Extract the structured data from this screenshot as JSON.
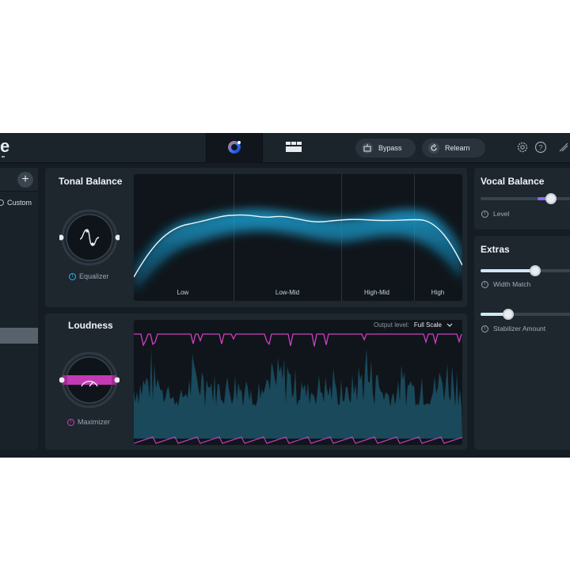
{
  "app": {
    "logo_letter": "e"
  },
  "toolbar": {
    "bypass_label": "Bypass",
    "relearn_label": "Relearn"
  },
  "left_panel": {
    "item_label": "Custom"
  },
  "tonal_balance": {
    "title": "Tonal Balance",
    "module_label": "Equalizer",
    "bands": [
      "Low",
      "Low-Mid",
      "High-Mid",
      "High"
    ]
  },
  "loudness": {
    "title": "Loudness",
    "module_label": "Maximizer",
    "output_level_label": "Output level:",
    "output_level_value": "Full Scale"
  },
  "vocal_balance": {
    "title": "Vocal Balance",
    "level_label": "Level",
    "level_value": 0.85
  },
  "extras": {
    "title": "Extras",
    "width_match_label": "Width Match",
    "width_match_value": 0.68,
    "stabilizer_label": "Stabilizer Amount",
    "stabilizer_value": 0.34
  },
  "colors": {
    "accent_blue": "#2bb8e8",
    "accent_magenta": "#d03fc0",
    "accent_purple": "#8a6bff",
    "slider_fill": "#cfe9f4"
  }
}
